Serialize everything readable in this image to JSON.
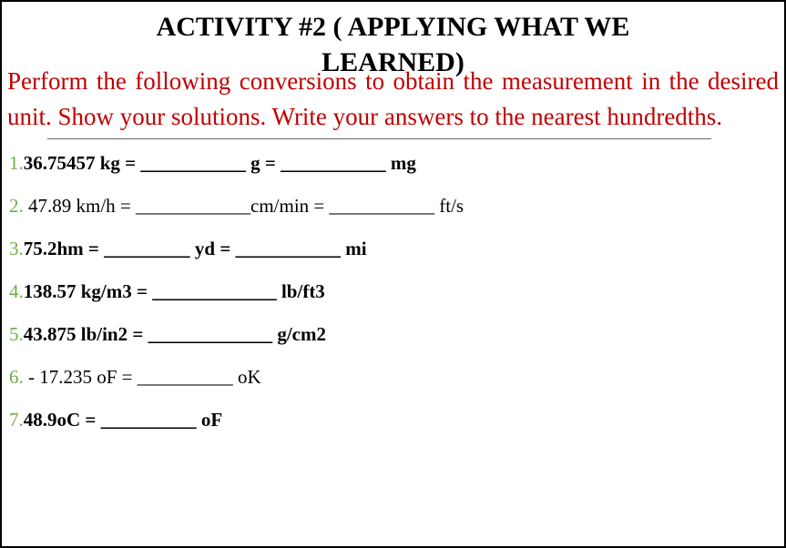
{
  "title_line1": "ACTIVITY #2  ( APPLYING WHAT WE",
  "title_line2": "LEARNED)",
  "instructions": "Perform the following conversions to obtain the measurement in the desired unit. Show your solutions. Write your answers to the nearest hundredths.",
  "problems": [
    {
      "num": "1.",
      "text": "36.75457 kg =  ___________ g = ___________ mg"
    },
    {
      "num": "2.",
      "text": " 47.89 km/h  =   ____________cm/min = ___________ ft/s"
    },
    {
      "num": "3.",
      "text": "75.2hm  =  _________ yd =  ___________ mi"
    },
    {
      "num": "4.",
      "text": "138.57 kg/m3  = _____________ lb/ft3"
    },
    {
      "num": "5.",
      "text": "43.875 lb/in2  =  _____________ g/cm2"
    },
    {
      "num": "6.",
      "text": " - 17.235 oF  =  __________ oK"
    },
    {
      "num": "7.",
      "text": "48.9oC = __________ oF"
    }
  ]
}
